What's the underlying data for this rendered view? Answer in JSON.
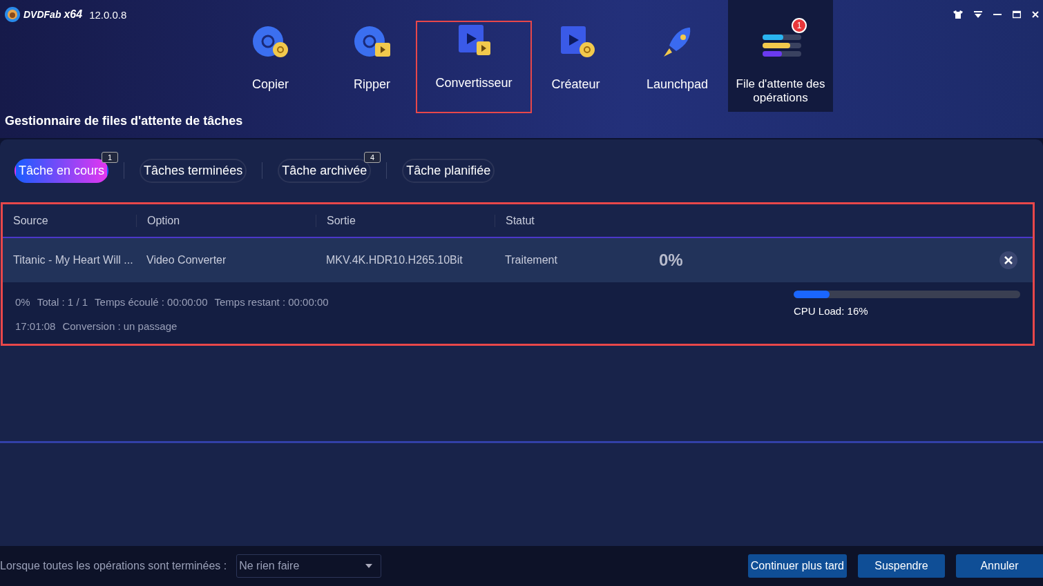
{
  "window": {
    "brand": "DVDFab",
    "arch": "x64",
    "version": "12.0.0.8"
  },
  "nav": [
    {
      "kind": "copy",
      "label": "Copier",
      "selected": false,
      "highlighted": false
    },
    {
      "kind": "rip",
      "label": "Ripper",
      "selected": false,
      "highlighted": false
    },
    {
      "kind": "convert",
      "label": "Convertisseur",
      "selected": false,
      "highlighted": true
    },
    {
      "kind": "create",
      "label": "Créateur",
      "selected": false,
      "highlighted": false
    },
    {
      "kind": "launch",
      "label": "Launchpad",
      "selected": false,
      "highlighted": false
    },
    {
      "kind": "queue",
      "label": "File d'attente des opérations",
      "selected": true,
      "highlighted": false,
      "badge": "1"
    }
  ],
  "heading": "Gestionnaire de files d'attente de tâches",
  "tabs": [
    {
      "label": "Tâche en cours",
      "selected": true,
      "badge": "1"
    },
    {
      "label": "Tâches terminées",
      "selected": false
    },
    {
      "label": "Tâche archivée",
      "selected": false,
      "badge": "4"
    },
    {
      "label": "Tâche planifiée",
      "selected": false
    }
  ],
  "table": {
    "highlighted": true,
    "columns": [
      "Source",
      "Option",
      "Sortie",
      "Statut"
    ],
    "rows": [
      {
        "source": "Titanic - My Heart Will ...",
        "option": "Video Converter",
        "output": "MKV.4K.HDR10.H265.10Bit",
        "status": "Traitement",
        "percent": "0%"
      }
    ],
    "details": {
      "line_1": [
        "0%",
        "Total : 1 / 1",
        "Temps écoulé : 00:00:00",
        "Temps restant : 00:00:00"
      ],
      "line_2": [
        "17:01:08",
        "Conversion : un passage"
      ]
    },
    "cpu": {
      "level": 0.16,
      "label": "CPU Load: 16%"
    }
  },
  "footer": {
    "label": "Lorsque toutes les opérations sont terminées :",
    "select_value": "Ne rien faire",
    "buttons": [
      "Continuer plus tard",
      "Suspendre",
      "Annuler"
    ]
  }
}
